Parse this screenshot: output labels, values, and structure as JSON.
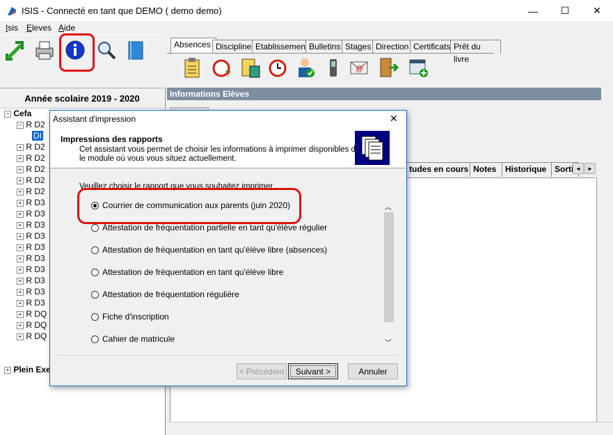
{
  "window": {
    "title": "ISIS - Connecté en tant que DEMO ( demo demo)",
    "controls": {
      "minimize": "—",
      "maximize": "☐",
      "close": "✕"
    }
  },
  "menubar": {
    "isis": "Isis",
    "eleves": "Eleves",
    "aide": "Aide"
  },
  "main_tabs": [
    "Absences",
    "Discipline",
    "Etablissement",
    "Bulletins",
    "Stages",
    "Direction",
    "Certificats",
    "Prêt du livre"
  ],
  "left_panel": {
    "year_header": "Année scolaire 2019 - 2020",
    "root": "Cefa",
    "items": [
      "R D2",
      "DI",
      "R D2",
      "R D2",
      "R D2",
      "R D2",
      "R D2",
      "R D3",
      "R D3",
      "R D3",
      "R D3",
      "R D3",
      "R D3",
      "R D3",
      "R D3",
      "R D3",
      "R D3",
      "R DQ",
      "R DQ",
      "R DQ"
    ],
    "footer_item": "Plein Exe"
  },
  "right_panel": {
    "header": "Informations Elèves",
    "tabs": [
      "tudes en cours",
      "Notes",
      "Historique",
      "Sorti"
    ],
    "scroll_left": "◄",
    "scroll_right": "►"
  },
  "dialog": {
    "title": "Assistant d'impression",
    "close": "✕",
    "header_title": "Impressions des rapports",
    "header_desc_line1": "Cet assistant vous permet de choisir les informations à imprimer disponibles dans",
    "header_desc_line2": "le module où vous vous situez actuellement.",
    "prompt": "Veuillez choisir le rapport que vous souhaitez imprimer",
    "options": [
      "Courrier de communication aux parents (juin 2020)",
      "Attestation de fréquentation partielle en tant qu'élève régulier",
      "Attestation de fréquentation en tant qu'élève libre (absences)",
      "Attestation de fréquentation en tant qu'élève libre",
      "Attestation de fréquentation régulière",
      "Fiche d'inscription",
      "Cahier de matricule"
    ],
    "selected_index": 0,
    "buttons": {
      "previous": "< Précédent",
      "next": "Suivant >",
      "cancel": "Annuler"
    }
  },
  "colors": {
    "highlight_red": "#e01010",
    "dialog_border": "#1b6ac9",
    "info_header": "#7f8da0"
  }
}
